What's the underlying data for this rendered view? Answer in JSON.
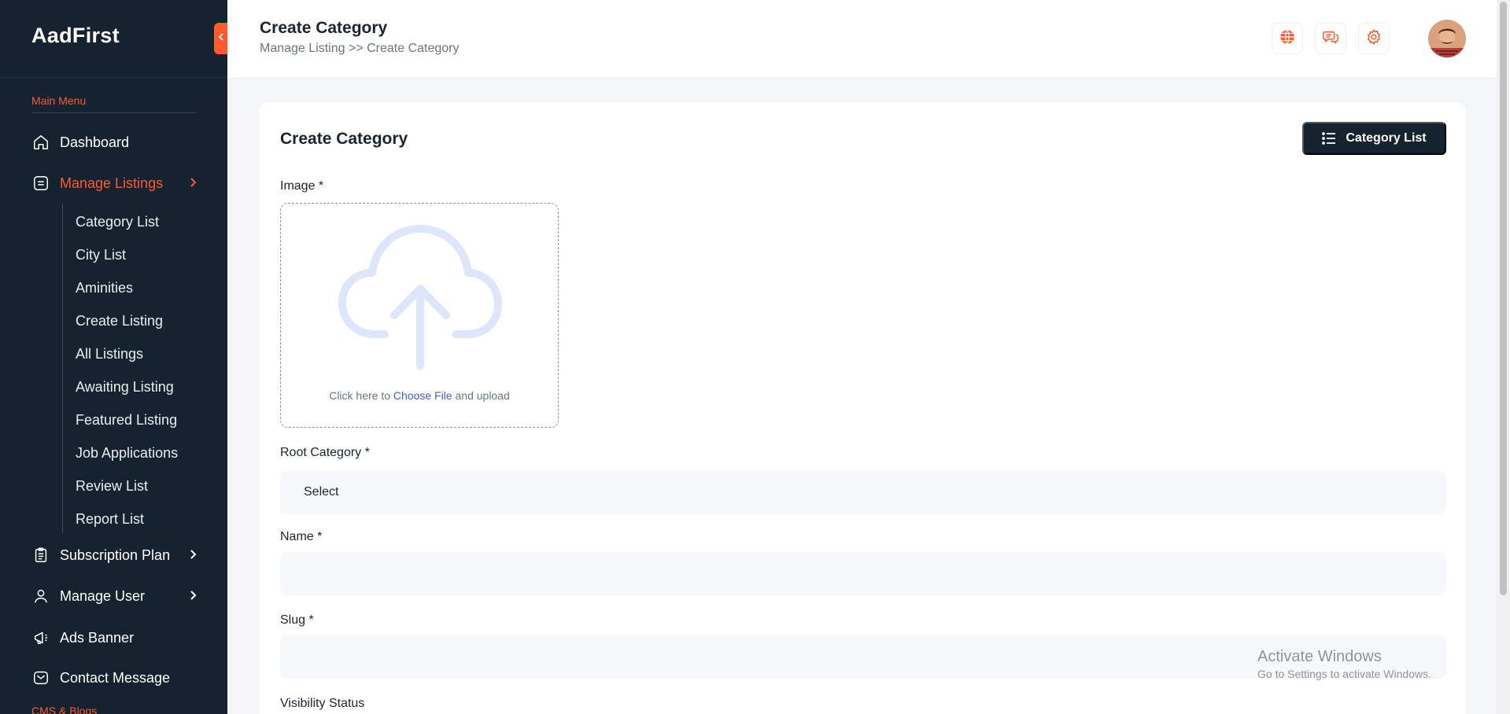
{
  "sidebar": {
    "logo": "AadFirst",
    "main_menu_label": "Main Menu",
    "cms_label": "CMS & Blogs",
    "items": [
      {
        "label": "Dashboard",
        "icon": "home-icon"
      },
      {
        "label": "Manage Listings",
        "icon": "list-box-icon",
        "active": true
      },
      {
        "label": "Subscription Plan",
        "icon": "clipboard-icon"
      },
      {
        "label": "Manage User",
        "icon": "user-icon"
      },
      {
        "label": "Ads Banner",
        "icon": "megaphone-icon"
      },
      {
        "label": "Contact Message",
        "icon": "mail-icon"
      }
    ],
    "submenu": [
      "Category List",
      "City List",
      "Aminities",
      "Create Listing",
      "All Listings",
      "Awaiting Listing",
      "Featured Listing",
      "Job Applications",
      "Review List",
      "Report List"
    ]
  },
  "header": {
    "title": "Create Category",
    "breadcrumb": "Manage Listing >> Create Category",
    "icons": [
      "globe-icon",
      "chat-icon",
      "gear-icon"
    ]
  },
  "form": {
    "card_title": "Create Category",
    "category_list_btn": "Category List",
    "image_label": "Image *",
    "upload_prefix": "Click here to",
    "upload_link": "Choose File",
    "upload_suffix": "and upload",
    "root_category_label": "Root Category *",
    "root_category_value": "Select",
    "name_label": "Name *",
    "slug_label": "Slug *",
    "visibility_label": "Visibility Status"
  },
  "watermark": {
    "line1": "Activate Windows",
    "line2": "Go to Settings to activate Windows."
  },
  "colors": {
    "sidebar_bg": "#14232f",
    "accent": "#fb5b2d",
    "link": "#3f5ed6"
  }
}
